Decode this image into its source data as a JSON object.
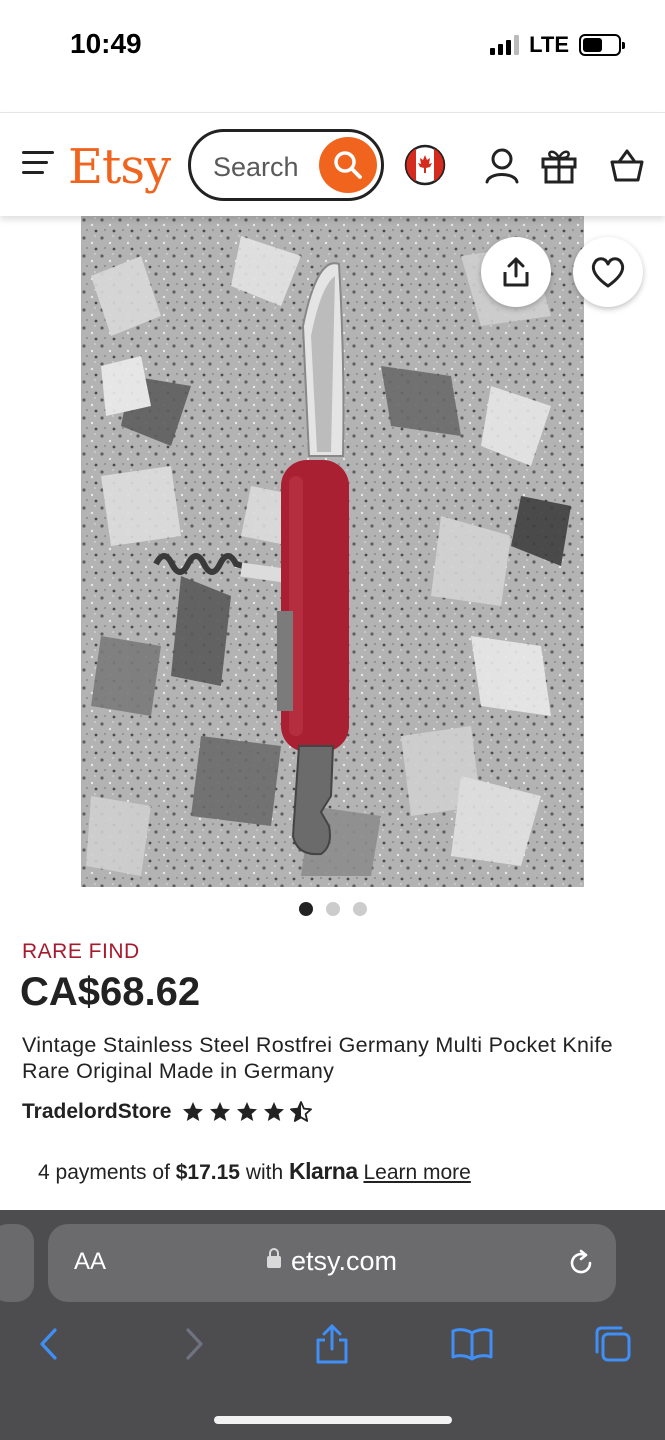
{
  "status": {
    "time": "10:49",
    "network": "LTE",
    "battery_level": 0.55
  },
  "header": {
    "logo": "Etsy",
    "search_placeholder": "Search",
    "colors": {
      "brand": "#f1641e"
    },
    "icons": [
      "menu-icon",
      "search-icon",
      "canada-flag-icon",
      "account-icon",
      "gift-icon",
      "cart-icon"
    ]
  },
  "gallery": {
    "image_count": 3,
    "active_index": 0
  },
  "listing": {
    "badge": "RARE FIND",
    "price": "CA$68.62",
    "title": "Vintage Stainless Steel Rostfrei Germany Multi Pocket Knife Rare Original Made in Germany",
    "shop": "TradelordStore",
    "rating": 4.5,
    "rating_max": 5,
    "badge_color": "#a61a2e"
  },
  "klarna": {
    "prefix": "4 payments of",
    "amount": "$17.15",
    "with": "with",
    "brand": "Klarna",
    "learn_more": "Learn more"
  },
  "browser": {
    "aa_label": "AA",
    "domain": "etsy.com",
    "accent": "#3f8ff6"
  }
}
